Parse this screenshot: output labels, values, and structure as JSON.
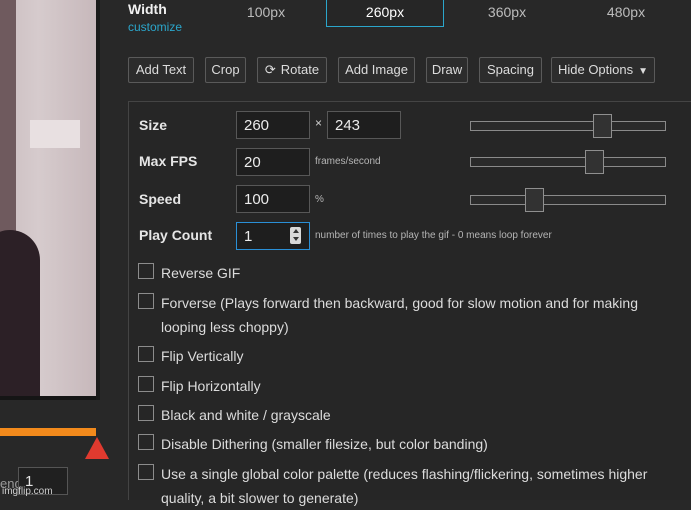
{
  "preview": {
    "end_label": "end",
    "end_value": "1",
    "watermark": "imgflip.com"
  },
  "width": {
    "label": "Width",
    "customize": "customize",
    "options": [
      "100px",
      "260px",
      "360px",
      "480px"
    ],
    "selected": "260px"
  },
  "tools": {
    "add_text": "Add Text",
    "crop": "Crop",
    "rotate": "Rotate",
    "add_image": "Add Image",
    "draw": "Draw",
    "spacing": "Spacing",
    "hide_options": "Hide Options"
  },
  "options": {
    "size": {
      "label": "Size",
      "width": "260",
      "times": "×",
      "height": "243",
      "slider_fraction": 0.7
    },
    "fps": {
      "label": "Max FPS",
      "value": "20",
      "unit": "frames/second",
      "slider_fraction": 0.65
    },
    "speed": {
      "label": "Speed",
      "value": "100",
      "unit": "%",
      "slider_fraction": 0.31
    },
    "play_count": {
      "label": "Play Count",
      "value": "1",
      "hint": "number of times to play the gif - 0 means loop forever"
    },
    "checkboxes": [
      {
        "label": "Reverse GIF",
        "checked": false
      },
      {
        "label": "Forverse (Plays forward then backward, good for slow motion and for making looping less choppy)",
        "checked": false
      },
      {
        "label": "Flip Vertically",
        "checked": false
      },
      {
        "label": "Flip Horizontally",
        "checked": false
      },
      {
        "label": "Black and white / grayscale",
        "checked": false
      },
      {
        "label": "Disable Dithering (smaller filesize, but color banding)",
        "checked": false
      },
      {
        "label": "Use a single global color palette (reduces flashing/flickering, sometimes higher quality, a bit slower to generate)",
        "checked": false
      }
    ]
  },
  "colors": {
    "accent": "#2ba6cb",
    "progress": "#f28a1c",
    "marker": "#e03a2f"
  }
}
